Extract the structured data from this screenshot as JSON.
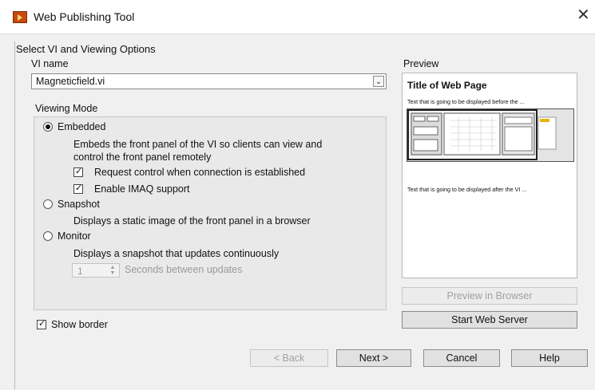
{
  "window": {
    "title": "Web Publishing Tool",
    "close_icon": "close-icon"
  },
  "group": {
    "label": "Select VI and Viewing Options"
  },
  "vi_name": {
    "label": "VI name",
    "value": "Magneticfield.vi"
  },
  "viewing_mode": {
    "label": "Viewing Mode",
    "selected": "Embedded",
    "embedded": {
      "label": "Embedded",
      "description_line1": "Embeds the front panel of the VI so clients can view and",
      "description_line2": "control the front panel remotely",
      "request_control": {
        "label": "Request control when connection is established",
        "checked": true
      },
      "enable_imaq": {
        "label": "Enable IMAQ support",
        "checked": true
      }
    },
    "snapshot": {
      "label": "Snapshot",
      "description": "Displays a static image of the front panel in a browser"
    },
    "monitor": {
      "label": "Monitor",
      "description": "Displays a snapshot that updates continuously",
      "interval_value": "1",
      "interval_label": "Seconds between updates"
    }
  },
  "show_border": {
    "label": "Show border",
    "checked": true
  },
  "preview": {
    "label": "Preview",
    "page_title": "Title of Web Page",
    "text_before": "Text that is going to be displayed before the ...",
    "text_after": "Text that is going to be displayed after the VI ...",
    "preview_in_browser": "Preview in Browser",
    "start_web_server": "Start Web Server"
  },
  "footer": {
    "back": "< Back",
    "next": "Next >",
    "cancel": "Cancel",
    "help": "Help"
  },
  "colors": {
    "app_icon": "#c54a0c",
    "dialog_bg": "#f0f0f0"
  }
}
